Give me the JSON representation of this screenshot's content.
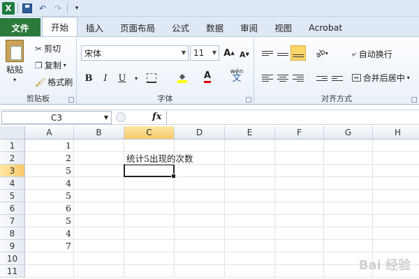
{
  "qat": {
    "app_icon": "X"
  },
  "tabs": [
    "文件",
    "开始",
    "插入",
    "页面布局",
    "公式",
    "数据",
    "审阅",
    "视图",
    "Acrobat"
  ],
  "ribbon": {
    "clipboard": {
      "paste": "粘贴",
      "cut": "剪切",
      "copy": "复制",
      "format_painter": "格式刷",
      "label": "剪贴板"
    },
    "font": {
      "name": "宋体",
      "size": "11",
      "grow": "A",
      "shrink": "A",
      "bold": "B",
      "italic": "I",
      "underline": "U",
      "font_color": "A",
      "phonetic": "wén",
      "phonetic2": "文",
      "label": "字体"
    },
    "alignment": {
      "wrap": "自动换行",
      "merge": "合并后居中",
      "label": "对齐方式"
    }
  },
  "formula_bar": {
    "name_box": "C3",
    "fx": "fx",
    "value": ""
  },
  "sheet": {
    "columns": [
      "A",
      "B",
      "C",
      "D",
      "E",
      "F",
      "G",
      "H"
    ],
    "rows": [
      "1",
      "2",
      "3",
      "4",
      "5",
      "6",
      "7",
      "8",
      "9",
      "10",
      "11"
    ],
    "selected_cell": "C3",
    "col_a_values": [
      "1",
      "2",
      "5",
      "4",
      "5",
      "6",
      "5",
      "4",
      "7"
    ],
    "c2_text": "统计5出现的次数"
  },
  "watermark": "Bai 经验"
}
